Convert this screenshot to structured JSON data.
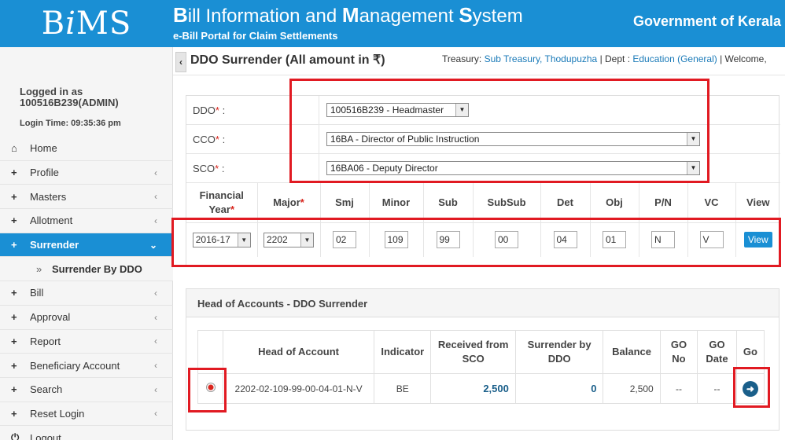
{
  "header": {
    "logo": "BiMS",
    "title": "Bill Information and Management System",
    "subtitle": "e-Bill Portal for Claim Settlements",
    "org": "Government of Kerala"
  },
  "user": {
    "logged_in_as_label": "Logged in as",
    "user_id": "100516B239(ADMIN)",
    "login_time": "Login Time: 09:35:36 pm"
  },
  "sidebar": {
    "items": [
      {
        "icon": "home-icon",
        "label": "Home"
      },
      {
        "icon": "plus-icon",
        "label": "Profile"
      },
      {
        "icon": "plus-icon",
        "label": "Masters"
      },
      {
        "icon": "plus-icon",
        "label": "Allotment"
      },
      {
        "icon": "plus-icon",
        "label": "Surrender"
      },
      {
        "icon": "double-chevron-right-icon",
        "label": "Surrender By DDO"
      },
      {
        "icon": "plus-icon",
        "label": "Bill"
      },
      {
        "icon": "plus-icon",
        "label": "Approval"
      },
      {
        "icon": "plus-icon",
        "label": "Report"
      },
      {
        "icon": "plus-icon",
        "label": "Beneficiary Account"
      },
      {
        "icon": "plus-icon",
        "label": "Search"
      },
      {
        "icon": "plus-icon",
        "label": "Reset Login"
      },
      {
        "icon": "logout-icon",
        "label": "Logout"
      }
    ]
  },
  "topbar": {
    "title": "DDO Surrender (All amount in ₹)",
    "treasury_label": "Treasury: ",
    "treasury_value": "Sub Treasury, Thodupuzha",
    "dept_label": " | Dept : ",
    "dept_value": "Education (General)",
    "welcome": " | Welcome,"
  },
  "filters": {
    "ddo_label": "DDO",
    "ddo_value": "100516B239 - Headmaster",
    "cco_label": "CCO",
    "cco_value": "16BA - Director of Public Instruction",
    "sco_label": "SCO",
    "sco_value": "16BA06 - Deputy Director",
    "colon": " :",
    "required_mark": "*"
  },
  "codes": {
    "headers": {
      "fy1": "Financial",
      "fy2": "Year",
      "major": "Major",
      "smj": "Smj",
      "minor": "Minor",
      "sub": "Sub",
      "subsub": "SubSub",
      "det": "Det",
      "obj": "Obj",
      "pn": "P/N",
      "vc": "VC",
      "view": "View"
    },
    "values": {
      "fy": "2016-17",
      "major": "2202",
      "smj": "02",
      "minor": "109",
      "sub": "99",
      "subsub": "00",
      "det": "04",
      "obj": "01",
      "pn": "N",
      "vc": "V"
    },
    "view_button": "View"
  },
  "hoa_panel": {
    "title": "Head of Accounts - DDO Surrender",
    "columns": {
      "hoa": "Head of Account",
      "indicator": "Indicator",
      "received1": "Received from",
      "received2": "SCO",
      "surrender1": "Surrender by",
      "surrender2": "DDO",
      "balance": "Balance",
      "gono1": "GO",
      "gono2": "No",
      "godate1": "GO",
      "godate2": "Date",
      "go": "Go"
    },
    "row": {
      "hoa": "2202-02-109-99-00-04-01-N-V",
      "indicator": "BE",
      "received": "2,500",
      "surrender": "0",
      "balance": "2,500",
      "gono": "--",
      "godate": "--"
    }
  }
}
